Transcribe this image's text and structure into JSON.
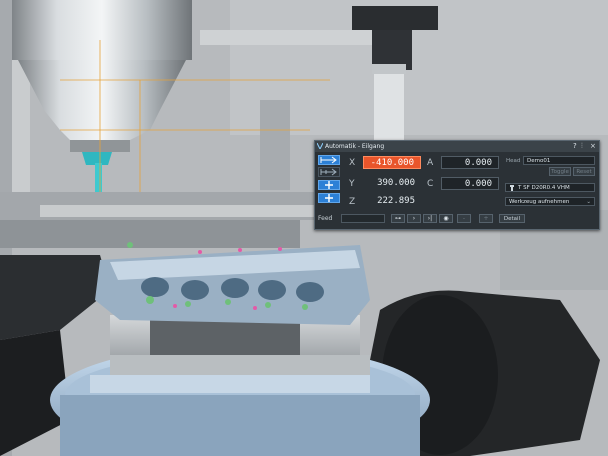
{
  "window": {
    "title": "Automatik - Eilgang",
    "controls": {
      "help": "?",
      "pin": "⫶",
      "close": "×"
    }
  },
  "axes": [
    {
      "name": "X",
      "value": "-410.000"
    },
    {
      "name": "Y",
      "value": "390.000"
    },
    {
      "name": "Z",
      "value": "222.895"
    },
    {
      "name": "A",
      "value": "0.000"
    },
    {
      "name": "C",
      "value": "0.000"
    }
  ],
  "head": {
    "label": "Head",
    "value": "Demo01",
    "toggle_label": "Toggle",
    "reset_label": "Reset"
  },
  "tool": {
    "name": "T SF D20R0.4 VHM",
    "icon": "tool-holder-icon"
  },
  "tool_action": {
    "label": "Werkzeug aufnehmen"
  },
  "feed": {
    "label": "Feed"
  },
  "playback": {
    "icons": [
      "step-back-icon",
      "forward-icon",
      "end-icon",
      "record-icon"
    ]
  },
  "detail": {
    "label": "Detail"
  },
  "colors": {
    "accent": "#2c80d6",
    "highlight": "#e9552b",
    "panel": "#2b3136"
  }
}
